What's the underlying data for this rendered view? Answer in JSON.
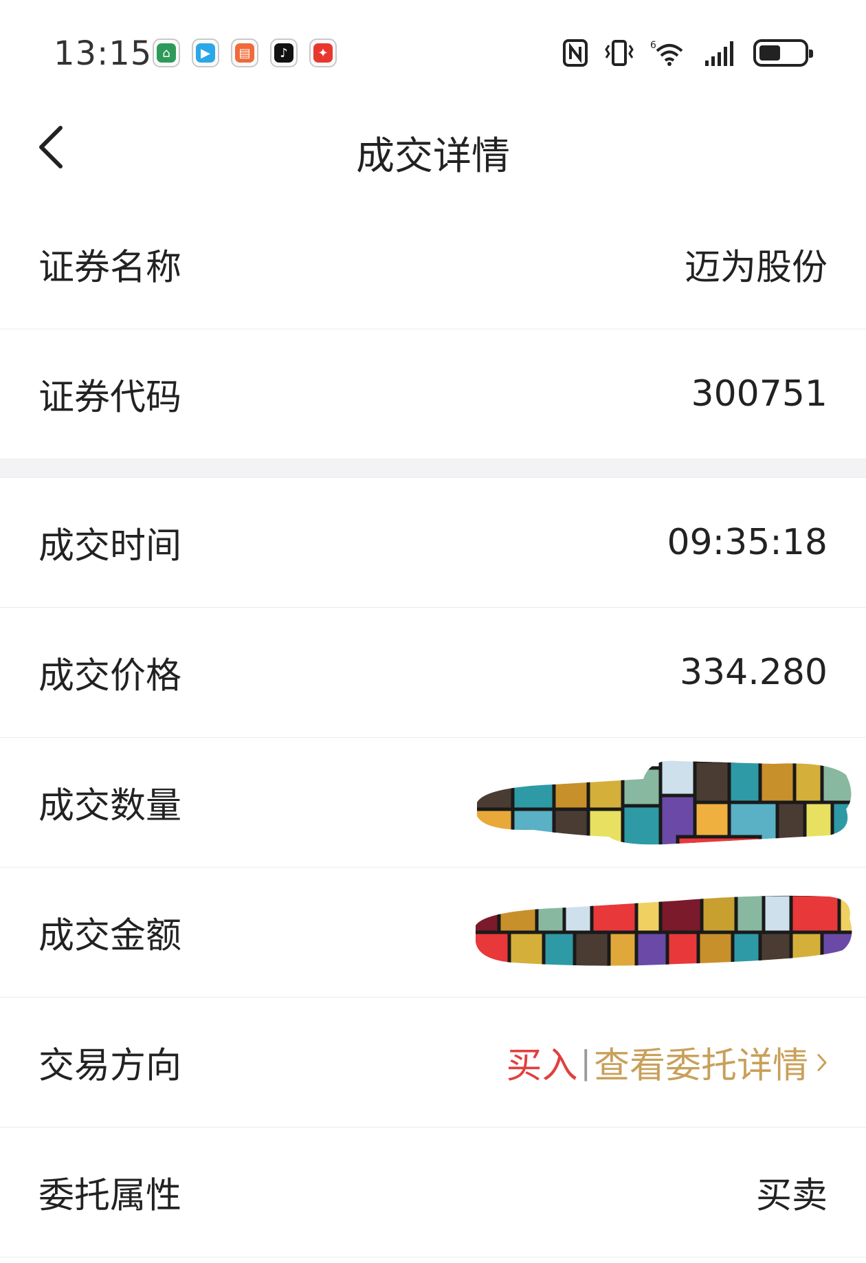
{
  "status_bar": {
    "time": "13:15",
    "app_icons": [
      {
        "name": "home-app-icon",
        "color": "#2e9a5a",
        "glyph": "⌂"
      },
      {
        "name": "video-app-icon",
        "color": "#2aa7e8",
        "glyph": "▶"
      },
      {
        "name": "book-app-icon",
        "color": "#f06a3a",
        "glyph": "▤"
      },
      {
        "name": "tiktok-app-icon",
        "color": "#111111",
        "glyph": "♪"
      },
      {
        "name": "gift-app-icon",
        "color": "#e8382e",
        "glyph": "✦"
      }
    ],
    "wifi_badge": "6"
  },
  "nav": {
    "title": "成交详情"
  },
  "info_section": [
    {
      "label": "证券名称",
      "value": "迈为股份"
    },
    {
      "label": "证券代码",
      "value": "300751"
    }
  ],
  "trade_section": {
    "time": {
      "label": "成交时间",
      "value": "09:35:18"
    },
    "price": {
      "label": "成交价格",
      "value": "334.280"
    },
    "quantity": {
      "label": "成交数量"
    },
    "amount": {
      "label": "成交金额"
    },
    "direction": {
      "label": "交易方向",
      "value": "买入",
      "separator": "|",
      "link": "查看委托详情"
    },
    "attribute": {
      "label": "委托属性",
      "value": "买卖"
    }
  },
  "colors": {
    "buy": "#e0403f",
    "link": "#c8a05a",
    "divider": "#ececec",
    "section_gap": "#f3f3f5"
  }
}
